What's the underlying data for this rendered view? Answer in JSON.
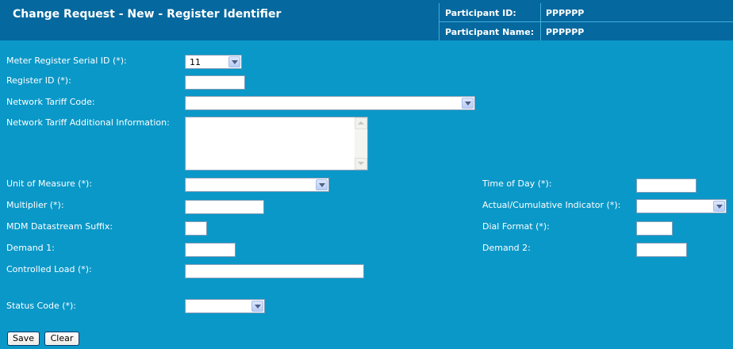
{
  "header": {
    "title": "Change Request - New - Register Identifier",
    "participant_id_label": "Participant ID:",
    "participant_id_value": "PPPPPP",
    "participant_name_label": "Participant Name:",
    "participant_name_value": "PPPPPP"
  },
  "form": {
    "meter_register_serial_id": {
      "label": "Meter Register Serial ID (*):",
      "value": "11"
    },
    "register_id": {
      "label": "Register ID (*):",
      "value": ""
    },
    "network_tariff_code": {
      "label": "Network Tariff Code:",
      "value": ""
    },
    "network_tariff_additional_info": {
      "label": "Network Tariff Additional Information:",
      "value": ""
    },
    "unit_of_measure": {
      "label": "Unit of Measure (*):",
      "value": ""
    },
    "multiplier": {
      "label": "Multiplier (*):",
      "value": ""
    },
    "mdm_datastream_suffix": {
      "label": "MDM Datastream Suffix:",
      "value": ""
    },
    "demand_1": {
      "label": "Demand 1:",
      "value": ""
    },
    "controlled_load": {
      "label": "Controlled Load (*):",
      "value": ""
    },
    "status_code": {
      "label": "Status Code (*):",
      "value": ""
    },
    "time_of_day": {
      "label": "Time of Day (*):",
      "value": ""
    },
    "actual_cumulative_indicator": {
      "label": "Actual/Cumulative Indicator (*):",
      "value": ""
    },
    "dial_format": {
      "label": "Dial Format (*):",
      "value": ""
    },
    "demand_2": {
      "label": "Demand 2:",
      "value": ""
    }
  },
  "buttons": {
    "save_label": "Save",
    "clear_label": "Clear"
  }
}
